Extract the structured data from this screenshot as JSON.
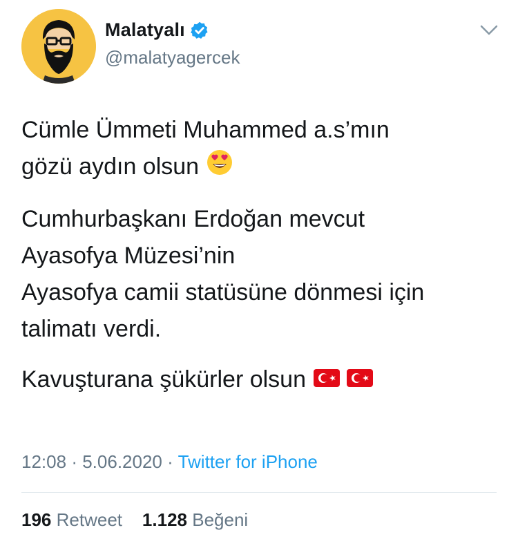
{
  "author": {
    "display_name": "Malatyalı",
    "handle": "@malatyagercek",
    "verified": true
  },
  "tweet": {
    "paragraphs": [
      {
        "lines": [
          "Cümle Ümmeti Muhammed a.s’mın",
          "gözü aydın olsun"
        ],
        "trailing_emoji": [
          "heart-eyes-emoji"
        ]
      },
      {
        "lines": [
          "Cumhurbaşkanı Erdoğan mevcut",
          "Ayasofya Müzesi’nin",
          "Ayasofya camii statüsüne dönmesi için",
          "talimatı verdi."
        ]
      },
      {
        "lines": [
          "Kavuşturana şükürler olsun"
        ],
        "trailing_emoji": [
          "turkey-flag-emoji",
          "turkey-flag-emoji"
        ]
      }
    ]
  },
  "meta": {
    "time": "12:08",
    "separator": "·",
    "date": "5.06.2020",
    "source": "Twitter for iPhone"
  },
  "stats": {
    "retweets_count": "196",
    "retweets_label": "Retweet",
    "likes_count": "1.128",
    "likes_label": "Beğeni"
  },
  "colors": {
    "verified_badge": "#1da1f2",
    "link": "#1da1f2",
    "secondary_text": "#657786",
    "avatar_bg": "#f6c343",
    "flag_red": "#e30a17"
  },
  "icons": {
    "verified": "verified-badge-icon",
    "caret": "chevron-down-icon"
  }
}
